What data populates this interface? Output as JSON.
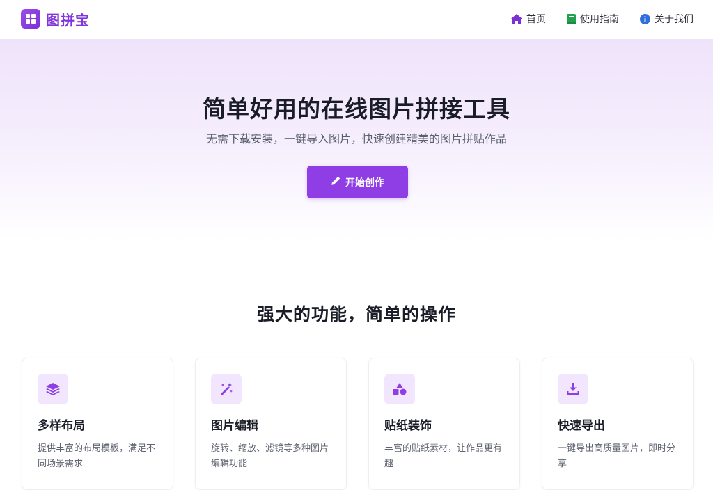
{
  "brand": {
    "name": "图拼宝",
    "icon": "grid-icon",
    "color": "#8235dc"
  },
  "nav": [
    {
      "label": "首页",
      "icon": "home-icon",
      "color": "#7b2fd6"
    },
    {
      "label": "使用指南",
      "icon": "book-icon",
      "color": "#22a14f"
    },
    {
      "label": "关于我们",
      "icon": "info-icon",
      "color": "#2f6fdc"
    }
  ],
  "hero": {
    "title": "简单好用的在线图片拼接工具",
    "subtitle": "无需下载安装，一键导入图片，快速创建精美的图片拼贴作品",
    "cta_label": "开始创作",
    "cta_icon": "pencil-icon",
    "accent": "#8f3ee6"
  },
  "features": {
    "title": "强大的功能，简单的操作",
    "cards": [
      {
        "icon": "layers-icon",
        "title": "多样布局",
        "desc": "提供丰富的布局模板，满足不同场景需求"
      },
      {
        "icon": "magic-wand-icon",
        "title": "图片编辑",
        "desc": "旋转、缩放、滤镜等多种图片编辑功能"
      },
      {
        "icon": "shapes-icon",
        "title": "贴纸装饰",
        "desc": "丰富的贴纸素材，让作品更有趣"
      },
      {
        "icon": "download-icon",
        "title": "快速导出",
        "desc": "一键导出高质量图片，即时分享"
      }
    ]
  }
}
